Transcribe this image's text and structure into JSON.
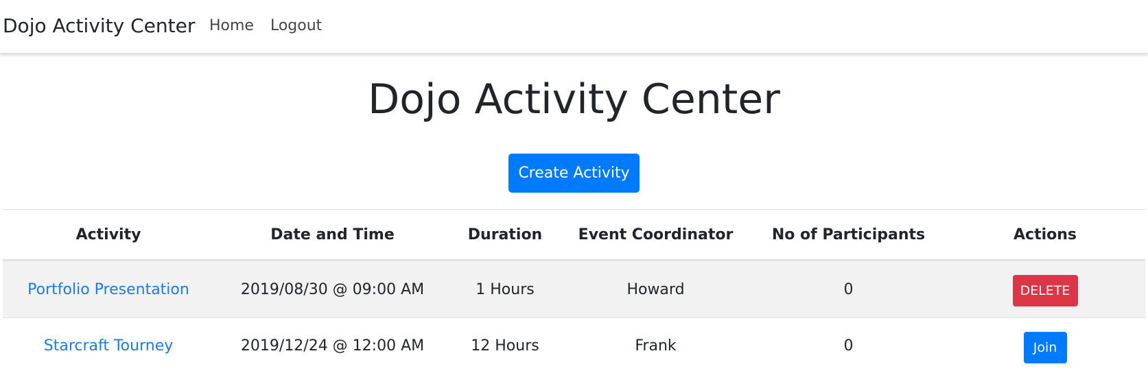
{
  "navbar": {
    "brand": "Dojo Activity Center",
    "links": [
      {
        "label": "Home"
      },
      {
        "label": "Logout"
      }
    ]
  },
  "main": {
    "title": "Dojo Activity Center",
    "create_button_label": "Create Activity",
    "table": {
      "headers": [
        "Activity",
        "Date and Time",
        "Duration",
        "Event Coordinator",
        "No of Participants",
        "Actions"
      ],
      "rows": [
        {
          "activity": "Portfolio Presentation",
          "datetime": "2019/08/30 @ 09:00 AM",
          "duration": "1 Hours",
          "coordinator": "Howard",
          "participants": "0",
          "action": "DELETE"
        },
        {
          "activity": "Starcraft Tourney",
          "datetime": "2019/12/24 @ 12:00 AM",
          "duration": "12 Hours",
          "coordinator": "Frank",
          "participants": "0",
          "action": "Join"
        }
      ]
    }
  },
  "colors": {
    "primary": "#007bff",
    "danger": "#dc3545",
    "link": "#1a7bea",
    "stripe": "#f2f2f2"
  }
}
